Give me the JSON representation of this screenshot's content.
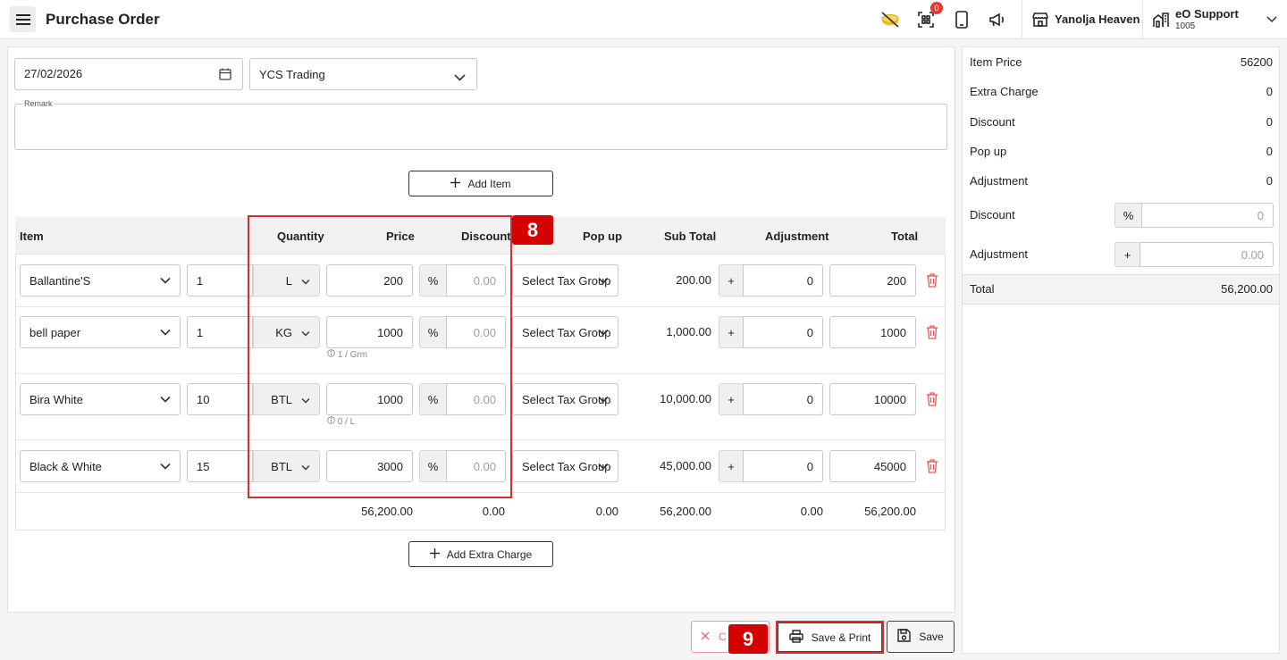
{
  "header": {
    "title": "Purchase Order",
    "notification_count": "0",
    "store_name": "Yanolja Heaven",
    "support_name": "eO Support",
    "support_id": "1005"
  },
  "form": {
    "date": "27/02/2026",
    "supplier": "YCS Trading",
    "remark_label": "Remark",
    "add_item_label": "Add Item",
    "add_extra_charge_label": "Add Extra Charge"
  },
  "table": {
    "headers": {
      "item": "Item",
      "quantity": "Quantity",
      "price": "Price",
      "discount": "Discount",
      "popup": "Pop up",
      "subtotal": "Sub Total",
      "adjustment": "Adjustment",
      "total": "Total"
    },
    "rows": [
      {
        "item": "Ballantine'S",
        "qty": "1",
        "unit": "L",
        "price": "200",
        "disc_type": "%",
        "disc_placeholder": "0.00",
        "tax": "Select Tax Group",
        "hint": "",
        "subtotal": "200.00",
        "adj_sign": "+",
        "adj": "0",
        "total": "200"
      },
      {
        "item": "bell paper",
        "qty": "1",
        "unit": "KG",
        "price": "1000",
        "disc_type": "%",
        "disc_placeholder": "0.00",
        "tax": "Select Tax Group",
        "hint": "1 / Grm",
        "subtotal": "1,000.00",
        "adj_sign": "+",
        "adj": "0",
        "total": "1000"
      },
      {
        "item": "Bira White",
        "qty": "10",
        "unit": "BTL",
        "price": "1000",
        "disc_type": "%",
        "disc_placeholder": "0.00",
        "tax": "Select Tax Group",
        "hint": "0 / L",
        "subtotal": "10,000.00",
        "adj_sign": "+",
        "adj": "0",
        "total": "10000"
      },
      {
        "item": "Black & White",
        "qty": "15",
        "unit": "BTL",
        "price": "3000",
        "disc_type": "%",
        "disc_placeholder": "0.00",
        "tax": "Select Tax Group",
        "hint": "",
        "subtotal": "45,000.00",
        "adj_sign": "+",
        "adj": "0",
        "total": "45000"
      }
    ],
    "footer": {
      "price": "56,200.00",
      "discount": "0.00",
      "popup": "0.00",
      "subtotal": "56,200.00",
      "adjustment": "0.00",
      "total": "56,200.00"
    }
  },
  "annotations": {
    "step_8": "8",
    "step_9": "9"
  },
  "summary": {
    "item_price_label": "Item Price",
    "item_price": "56200",
    "extra_charge_label": "Extra Charge",
    "extra_charge": "0",
    "discount_label": "Discount",
    "discount": "0",
    "popup_label": "Pop up",
    "popup": "0",
    "adjustment_label": "Adjustment",
    "adjustment": "0",
    "discount_input_label": "Discount",
    "discount_input_type": "%",
    "discount_input_placeholder": "0",
    "adjustment_input_label": "Adjustment",
    "adjustment_input_sign": "+",
    "adjustment_input_placeholder": "0.00",
    "total_label": "Total",
    "total": "56,200.00"
  },
  "actions": {
    "cancel_label": "C",
    "save_print_label": "Save & Print",
    "save_label": "Save"
  },
  "colors": {
    "accent_red": "#d32f2f",
    "badge_red": "#d50000",
    "border": "#c9c9c9"
  }
}
